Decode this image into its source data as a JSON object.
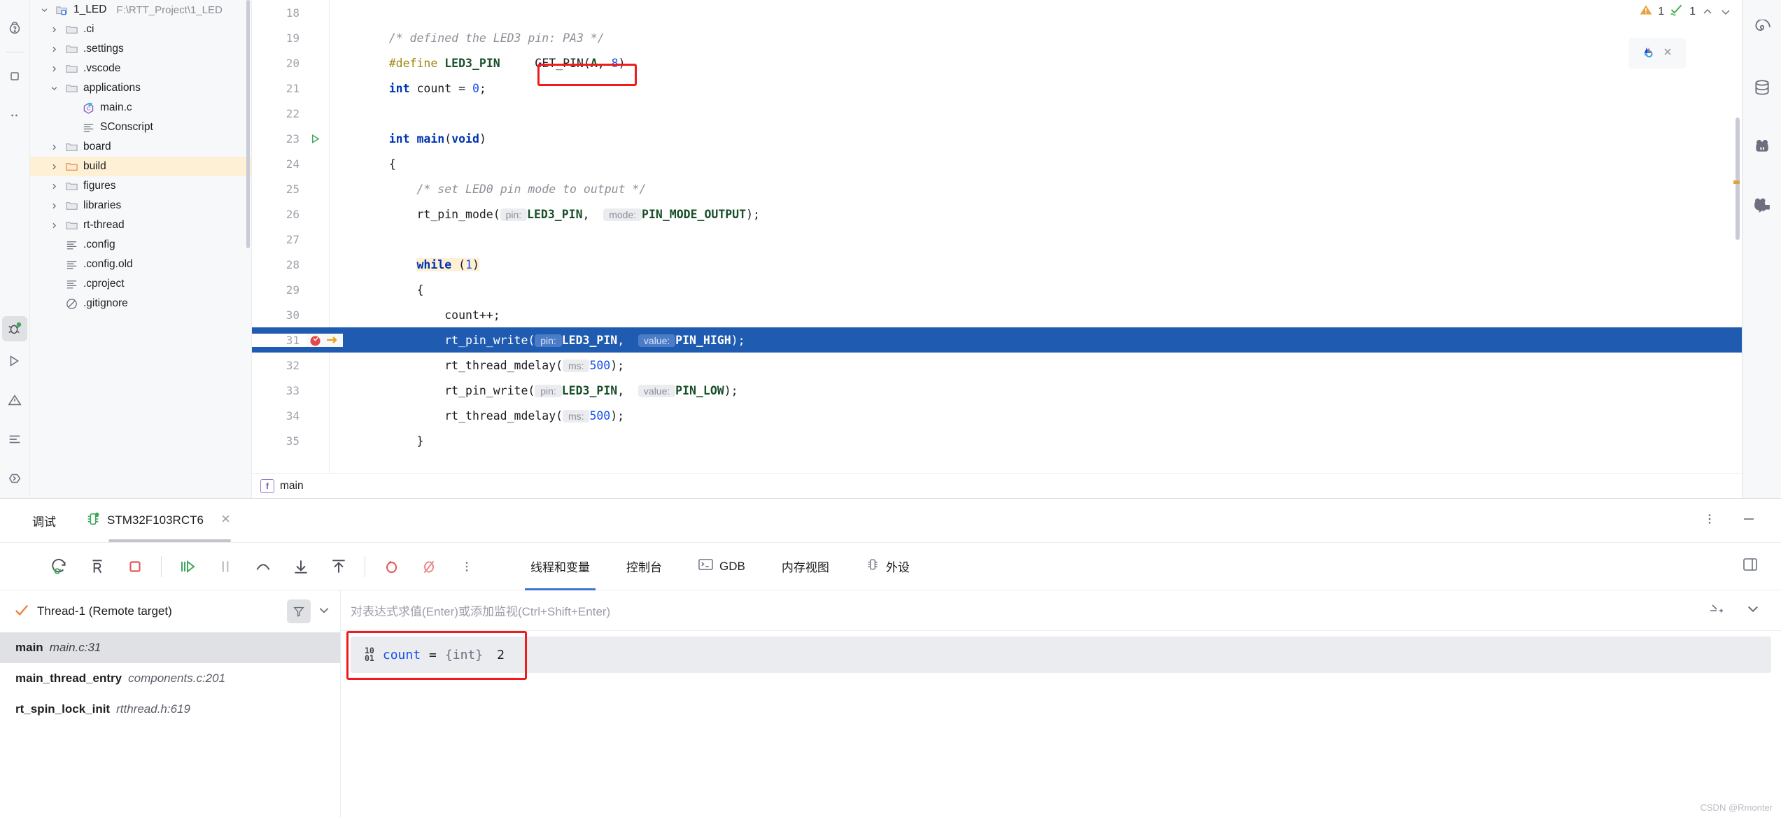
{
  "project_tree": {
    "root": {
      "name": "1_LED",
      "path": "F:\\RTT_Project\\1_LED"
    },
    "items": [
      {
        "label": ".ci",
        "icon": "folder-icon",
        "indent": 1,
        "twisty": "chevron-right-icon",
        "kind": "folder"
      },
      {
        "label": ".settings",
        "icon": "folder-icon",
        "indent": 1,
        "twisty": "chevron-right-icon",
        "kind": "folder"
      },
      {
        "label": ".vscode",
        "icon": "folder-icon",
        "indent": 1,
        "twisty": "chevron-right-icon",
        "kind": "folder"
      },
      {
        "label": "applications",
        "icon": "folder-icon",
        "indent": 1,
        "twisty": "chevron-down-icon",
        "kind": "folder"
      },
      {
        "label": "main.c",
        "icon": "c-file-icon",
        "indent": 2,
        "twisty": "",
        "kind": "file"
      },
      {
        "label": "SConscript",
        "icon": "script-file-icon",
        "indent": 2,
        "twisty": "",
        "kind": "file"
      },
      {
        "label": "board",
        "icon": "folder-icon",
        "indent": 1,
        "twisty": "chevron-right-icon",
        "kind": "folder"
      },
      {
        "label": "build",
        "icon": "folder-orange-icon",
        "indent": 1,
        "twisty": "chevron-right-icon",
        "kind": "folder",
        "highlighted": true
      },
      {
        "label": "figures",
        "icon": "folder-icon",
        "indent": 1,
        "twisty": "chevron-right-icon",
        "kind": "folder"
      },
      {
        "label": "libraries",
        "icon": "folder-icon",
        "indent": 1,
        "twisty": "chevron-right-icon",
        "kind": "folder"
      },
      {
        "label": "rt-thread",
        "icon": "folder-icon",
        "indent": 1,
        "twisty": "chevron-right-icon",
        "kind": "folder"
      },
      {
        "label": ".config",
        "icon": "script-file-icon",
        "indent": 1,
        "twisty": "",
        "kind": "file"
      },
      {
        "label": ".config.old",
        "icon": "script-file-icon",
        "indent": 1,
        "twisty": "",
        "kind": "file"
      },
      {
        "label": ".cproject",
        "icon": "script-file-icon",
        "indent": 1,
        "twisty": "",
        "kind": "file"
      },
      {
        "label": ".gitignore",
        "icon": "gitignore-icon",
        "indent": 1,
        "twisty": "",
        "kind": "file"
      }
    ]
  },
  "editor": {
    "inspection": {
      "warning_count": "1",
      "ok_count": "1"
    },
    "breadcrumb": {
      "badge": "f",
      "label": "main"
    },
    "lines": [
      {
        "n": "18",
        "tokens": []
      },
      {
        "n": "19",
        "tokens": [
          {
            "t": "    ",
            "c": ""
          },
          {
            "t": "/* defined the LED3 pin: PA3 */",
            "c": "cm"
          }
        ]
      },
      {
        "n": "20",
        "tokens": [
          {
            "t": "    ",
            "c": ""
          },
          {
            "t": "#define ",
            "c": "mac"
          },
          {
            "t": "LED3_PIN",
            "c": "mac-name"
          },
          {
            "t": "     GET_PIN(",
            "c": ""
          },
          {
            "t": "A",
            "c": "mac-name"
          },
          {
            "t": ", ",
            "c": ""
          },
          {
            "t": "8",
            "c": "num"
          },
          {
            "t": ")",
            "c": ""
          }
        ]
      },
      {
        "n": "21",
        "tokens": [
          {
            "t": "    ",
            "c": ""
          },
          {
            "t": "int",
            "c": "kw"
          },
          {
            "t": " count = ",
            "c": ""
          },
          {
            "t": "0",
            "c": "num"
          },
          {
            "t": ";",
            "c": ""
          }
        ],
        "boxed": true
      },
      {
        "n": "22",
        "tokens": []
      },
      {
        "n": "23",
        "tokens": [
          {
            "t": "    ",
            "c": ""
          },
          {
            "t": "int",
            "c": "kw"
          },
          {
            "t": " ",
            "c": ""
          },
          {
            "t": "main",
            "c": "kw"
          },
          {
            "t": "(",
            "c": ""
          },
          {
            "t": "void",
            "c": "kw"
          },
          {
            "t": ")",
            "c": ""
          }
        ],
        "gutter_mark": "run-gutter-icon"
      },
      {
        "n": "24",
        "tokens": [
          {
            "t": "    {",
            "c": ""
          }
        ]
      },
      {
        "n": "25",
        "tokens": [
          {
            "t": "        ",
            "c": ""
          },
          {
            "t": "/* set LED0 pin mode to output */",
            "c": "cm"
          }
        ]
      },
      {
        "n": "26",
        "tokens": [
          {
            "t": "        rt_pin_mode(",
            "c": ""
          },
          {
            "t": " pin: ",
            "c": "hint"
          },
          {
            "t": "LED3_PIN",
            "c": "mac-name"
          },
          {
            "t": ",  ",
            "c": ""
          },
          {
            "t": " mode: ",
            "c": "hint"
          },
          {
            "t": "PIN_MODE_OUTPUT",
            "c": "mac-name"
          },
          {
            "t": ");",
            "c": ""
          }
        ]
      },
      {
        "n": "27",
        "tokens": []
      },
      {
        "n": "28",
        "tokens": [
          {
            "t": "        ",
            "c": ""
          },
          {
            "t": "while",
            "c": "kw hl-y"
          },
          {
            "t": " ",
            "c": "hl-y"
          },
          {
            "t": "(",
            "c": "hl-y"
          },
          {
            "t": "1",
            "c": "num hl-y"
          },
          {
            "t": ")",
            "c": "hl-y"
          }
        ]
      },
      {
        "n": "29",
        "tokens": [
          {
            "t": "        {",
            "c": ""
          }
        ]
      },
      {
        "n": "30",
        "tokens": [
          {
            "t": "            count++;",
            "c": ""
          }
        ]
      },
      {
        "n": "31",
        "tokens": [
          {
            "t": "            rt_pin_write(",
            "c": ""
          },
          {
            "t": " pin: ",
            "c": "hint"
          },
          {
            "t": "LED3_PIN",
            "c": "mac-name"
          },
          {
            "t": ",  ",
            "c": ""
          },
          {
            "t": " value: ",
            "c": "hint"
          },
          {
            "t": "PIN_HIGH",
            "c": "mac-name"
          },
          {
            "t": ");",
            "c": ""
          }
        ],
        "current": true,
        "gutter_mark": "breakpoint-icon",
        "hide_number": true
      },
      {
        "n": "32",
        "tokens": [
          {
            "t": "            rt_thread_mdelay(",
            "c": ""
          },
          {
            "t": " ms: ",
            "c": "hint"
          },
          {
            "t": "500",
            "c": "num"
          },
          {
            "t": ");",
            "c": ""
          }
        ]
      },
      {
        "n": "33",
        "tokens": [
          {
            "t": "            rt_pin_write(",
            "c": ""
          },
          {
            "t": " pin: ",
            "c": "hint"
          },
          {
            "t": "LED3_PIN",
            "c": "mac-name"
          },
          {
            "t": ",  ",
            "c": ""
          },
          {
            "t": " value: ",
            "c": "hint"
          },
          {
            "t": "PIN_LOW",
            "c": "mac-name"
          },
          {
            "t": ");",
            "c": ""
          }
        ]
      },
      {
        "n": "34",
        "tokens": [
          {
            "t": "            rt_thread_mdelay(",
            "c": ""
          },
          {
            "t": " ms: ",
            "c": "hint"
          },
          {
            "t": "500",
            "c": "num"
          },
          {
            "t": ");",
            "c": ""
          }
        ]
      },
      {
        "n": "35",
        "tokens": [
          {
            "t": "        }",
            "c": ""
          }
        ]
      }
    ]
  },
  "debug": {
    "title": "调试",
    "session_tab": "STM32F103RCT6",
    "toolbar_buttons": [
      {
        "name": "rerun-debug-button",
        "icon": "rerun-debug-icon"
      },
      {
        "name": "restart-button",
        "icon": "restart-r-icon"
      },
      {
        "name": "stop-button",
        "icon": "stop-square-icon"
      },
      {
        "name": "resume-button",
        "icon": "resume-icon"
      },
      {
        "name": "pause-button",
        "icon": "pause-icon"
      },
      {
        "name": "step-over-button",
        "icon": "step-over-icon"
      },
      {
        "name": "step-into-button",
        "icon": "step-into-icon"
      },
      {
        "name": "step-out-button",
        "icon": "step-out-icon"
      },
      {
        "name": "view-breakpoints-button",
        "icon": "breakpoints-icon"
      },
      {
        "name": "mute-breakpoints-button",
        "icon": "mute-breakpoints-icon"
      },
      {
        "name": "more-options-button",
        "icon": "more-vertical-icon"
      }
    ],
    "tabs": [
      {
        "label": "线程和变量",
        "icon": "",
        "active": true
      },
      {
        "label": "控制台",
        "icon": "",
        "active": false
      },
      {
        "label": "GDB",
        "icon": "terminal-icon",
        "active": false
      },
      {
        "label": "内存视图",
        "icon": "",
        "active": false
      },
      {
        "label": "外设",
        "icon": "chip-icon",
        "active": false
      }
    ],
    "thread": {
      "label": "Thread-1 (Remote target)"
    },
    "frames": [
      {
        "fn": "main",
        "loc": "main.c:31",
        "selected": true
      },
      {
        "fn": "main_thread_entry",
        "loc": "components.c:201",
        "selected": false
      },
      {
        "fn": "rt_spin_lock_init",
        "loc": "rtthread.h:619",
        "selected": false
      }
    ],
    "expression_placeholder": "对表达式求值(Enter)或添加监视(Ctrl+Shift+Enter)",
    "variables": [
      {
        "badge": "10\n01",
        "name": "count",
        "eq": " = ",
        "type": "{int}",
        "value": "2",
        "boxed": true
      }
    ]
  },
  "watermark": "CSDN @Rmonter",
  "colors": {
    "accent_blue": "#1f5bb0",
    "highlight_red": "#ee1c1c",
    "tree_highlight": "#fdf0d5",
    "tab_active": "#3b76d4"
  }
}
